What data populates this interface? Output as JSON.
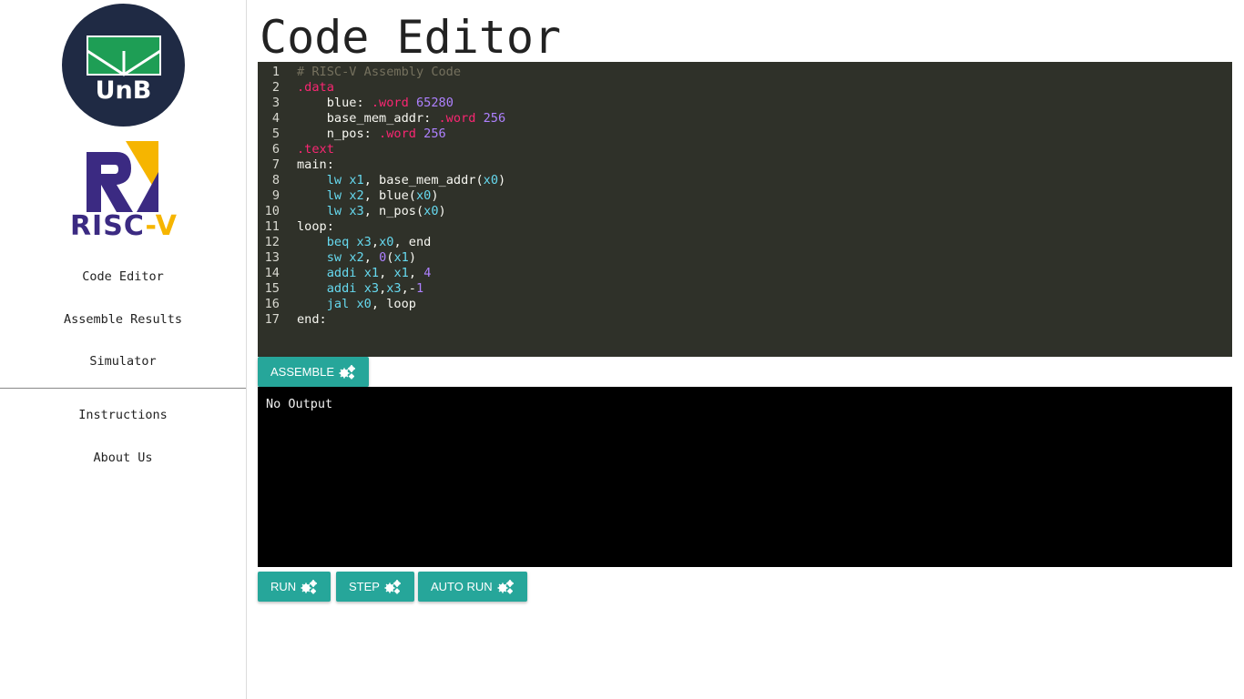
{
  "sidebar": {
    "unb_logo_text": "UnB",
    "riscv_logo_text": "RISC",
    "riscv_logo_dash": "-V",
    "nav": [
      {
        "label": "Code Editor"
      },
      {
        "label": "Assemble Results"
      },
      {
        "label": "Simulator"
      },
      {
        "label": "Instructions"
      },
      {
        "label": "About Us"
      }
    ]
  },
  "page": {
    "title": "Code Editor"
  },
  "editor": {
    "lines": [
      {
        "n": "1",
        "tokens": [
          {
            "t": "# RISC-V Assembly Code",
            "c": "c-com"
          }
        ]
      },
      {
        "n": "2",
        "tokens": [
          {
            "t": ".data",
            "c": "c-dir"
          }
        ]
      },
      {
        "n": "3",
        "tokens": [
          {
            "t": "    blue: ",
            "c": "c-txt"
          },
          {
            "t": ".word",
            "c": "c-dir"
          },
          {
            "t": " ",
            "c": "c-txt"
          },
          {
            "t": "65280",
            "c": "c-num"
          }
        ]
      },
      {
        "n": "4",
        "tokens": [
          {
            "t": "    base_mem_addr: ",
            "c": "c-txt"
          },
          {
            "t": ".word",
            "c": "c-dir"
          },
          {
            "t": " ",
            "c": "c-txt"
          },
          {
            "t": "256",
            "c": "c-num"
          }
        ]
      },
      {
        "n": "5",
        "tokens": [
          {
            "t": "    n_pos: ",
            "c": "c-txt"
          },
          {
            "t": ".word",
            "c": "c-dir"
          },
          {
            "t": " ",
            "c": "c-txt"
          },
          {
            "t": "256",
            "c": "c-num"
          }
        ]
      },
      {
        "n": "6",
        "tokens": [
          {
            "t": ".text",
            "c": "c-dir"
          }
        ]
      },
      {
        "n": "7",
        "tokens": [
          {
            "t": "main:",
            "c": "c-txt"
          }
        ]
      },
      {
        "n": "8",
        "tokens": [
          {
            "t": "    ",
            "c": "c-txt"
          },
          {
            "t": "lw",
            "c": "c-ins"
          },
          {
            "t": " ",
            "c": "c-txt"
          },
          {
            "t": "x1",
            "c": "c-reg"
          },
          {
            "t": ", base_mem_addr(",
            "c": "c-txt"
          },
          {
            "t": "x0",
            "c": "c-reg"
          },
          {
            "t": ")",
            "c": "c-txt"
          }
        ]
      },
      {
        "n": "9",
        "tokens": [
          {
            "t": "    ",
            "c": "c-txt"
          },
          {
            "t": "lw",
            "c": "c-ins"
          },
          {
            "t": " ",
            "c": "c-txt"
          },
          {
            "t": "x2",
            "c": "c-reg"
          },
          {
            "t": ", blue(",
            "c": "c-txt"
          },
          {
            "t": "x0",
            "c": "c-reg"
          },
          {
            "t": ")",
            "c": "c-txt"
          }
        ]
      },
      {
        "n": "10",
        "tokens": [
          {
            "t": "    ",
            "c": "c-txt"
          },
          {
            "t": "lw",
            "c": "c-ins"
          },
          {
            "t": " ",
            "c": "c-txt"
          },
          {
            "t": "x3",
            "c": "c-reg"
          },
          {
            "t": ", n_pos(",
            "c": "c-txt"
          },
          {
            "t": "x0",
            "c": "c-reg"
          },
          {
            "t": ")",
            "c": "c-txt"
          }
        ]
      },
      {
        "n": "11",
        "tokens": [
          {
            "t": "loop:",
            "c": "c-txt"
          }
        ]
      },
      {
        "n": "12",
        "tokens": [
          {
            "t": "    ",
            "c": "c-txt"
          },
          {
            "t": "beq",
            "c": "c-ins"
          },
          {
            "t": " ",
            "c": "c-txt"
          },
          {
            "t": "x3",
            "c": "c-reg"
          },
          {
            "t": ",",
            "c": "c-txt"
          },
          {
            "t": "x0",
            "c": "c-reg"
          },
          {
            "t": ", end",
            "c": "c-txt"
          }
        ]
      },
      {
        "n": "13",
        "tokens": [
          {
            "t": "    ",
            "c": "c-txt"
          },
          {
            "t": "sw",
            "c": "c-ins"
          },
          {
            "t": " ",
            "c": "c-txt"
          },
          {
            "t": "x2",
            "c": "c-reg"
          },
          {
            "t": ", ",
            "c": "c-txt"
          },
          {
            "t": "0",
            "c": "c-num"
          },
          {
            "t": "(",
            "c": "c-txt"
          },
          {
            "t": "x1",
            "c": "c-reg"
          },
          {
            "t": ")",
            "c": "c-txt"
          }
        ]
      },
      {
        "n": "14",
        "tokens": [
          {
            "t": "    ",
            "c": "c-txt"
          },
          {
            "t": "addi",
            "c": "c-ins"
          },
          {
            "t": " ",
            "c": "c-txt"
          },
          {
            "t": "x1",
            "c": "c-reg"
          },
          {
            "t": ", ",
            "c": "c-txt"
          },
          {
            "t": "x1",
            "c": "c-reg"
          },
          {
            "t": ", ",
            "c": "c-txt"
          },
          {
            "t": "4",
            "c": "c-num"
          }
        ]
      },
      {
        "n": "15",
        "tokens": [
          {
            "t": "    ",
            "c": "c-txt"
          },
          {
            "t": "addi",
            "c": "c-ins"
          },
          {
            "t": " ",
            "c": "c-txt"
          },
          {
            "t": "x3",
            "c": "c-reg"
          },
          {
            "t": ",",
            "c": "c-txt"
          },
          {
            "t": "x3",
            "c": "c-reg"
          },
          {
            "t": ",-",
            "c": "c-txt"
          },
          {
            "t": "1",
            "c": "c-num"
          }
        ]
      },
      {
        "n": "16",
        "tokens": [
          {
            "t": "    ",
            "c": "c-txt"
          },
          {
            "t": "jal",
            "c": "c-ins"
          },
          {
            "t": " ",
            "c": "c-txt"
          },
          {
            "t": "x0",
            "c": "c-reg"
          },
          {
            "t": ", loop",
            "c": "c-txt"
          }
        ]
      },
      {
        "n": "17",
        "tokens": [
          {
            "t": "end:",
            "c": "c-txt"
          }
        ]
      }
    ]
  },
  "buttons": {
    "assemble": "ASSEMBLE",
    "run": "RUN",
    "step": "STEP",
    "auto_run": "AUTO RUN",
    "icon": "gears-icon"
  },
  "output": {
    "text": "No Output"
  },
  "colors": {
    "accent": "#26a69a",
    "editor_bg": "#2f3129",
    "output_bg": "#000000",
    "unb_circle": "#1f2a44",
    "unb_green": "#1e9e55",
    "riscv_purple": "#3b2a82",
    "riscv_yellow": "#f6b500"
  }
}
